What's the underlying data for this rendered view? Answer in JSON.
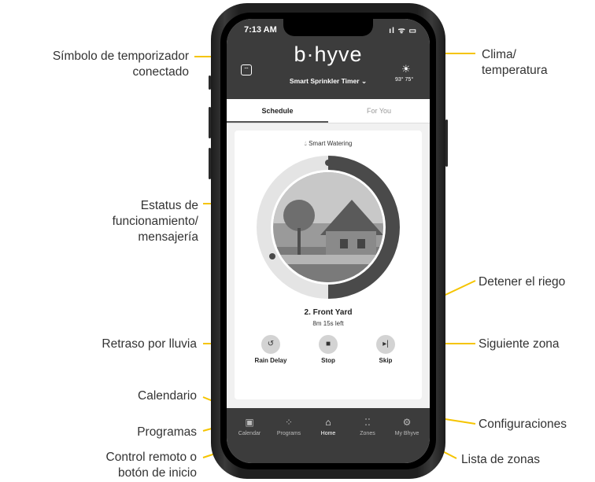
{
  "phone": {
    "time": "7:13 AM",
    "status_icons": "ıl ᯤ ▭",
    "logo": "b·hyve",
    "device_name": "Smart Sprinkler Timer ⌄",
    "weather": {
      "temp": "93°  75°"
    },
    "tabs": [
      {
        "label": "Schedule",
        "active": true
      },
      {
        "label": "For You",
        "active": false
      }
    ],
    "smart_watering": "Smart Watering",
    "zone": {
      "name": "2. Front Yard",
      "time_left": "8m 15s left"
    },
    "progress_fraction": 0.5,
    "controls": [
      {
        "label": "Rain Delay",
        "icon": "rain-delay-icon"
      },
      {
        "label": "Stop",
        "icon": "stop-icon"
      },
      {
        "label": "Skip",
        "icon": "skip-icon"
      }
    ],
    "nav": [
      {
        "label": "Calendar",
        "icon": "calendar-icon"
      },
      {
        "label": "Programs",
        "icon": "programs-icon"
      },
      {
        "label": "Home",
        "icon": "home-icon",
        "active": true
      },
      {
        "label": "Zones",
        "icon": "zones-icon"
      },
      {
        "label": "My Bhyve",
        "icon": "settings-icon"
      }
    ]
  },
  "annotations": {
    "timer_symbol": "Símbolo de temporizador\nconectado",
    "weather": "Clima/\ntemperatura",
    "status": "Estatus de\nfuncionamiento/\nmensajería",
    "stop_watering": "Detener el riego",
    "rain_delay": "Retraso por lluvia",
    "next_zone": "Siguiente zona",
    "calendar": "Calendario",
    "settings": "Configuraciones",
    "programs": "Programas",
    "remote": "Control remoto o\nbotón de inicio",
    "zones_list": "Lista de zonas"
  },
  "colors": {
    "accent": "#f5c400",
    "bar": "#3c3c3c",
    "progress": "#4a4a4a",
    "ring": "#e4e4e4"
  }
}
